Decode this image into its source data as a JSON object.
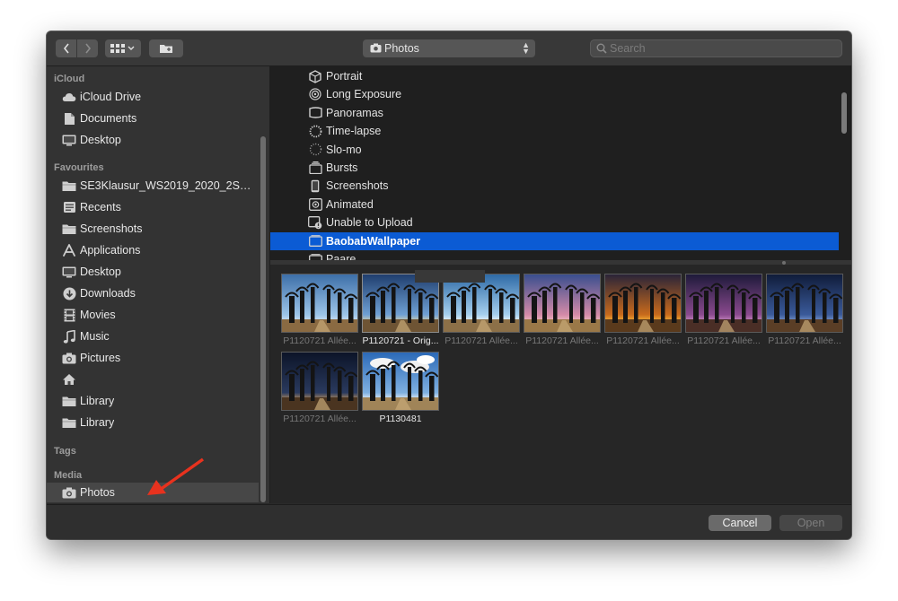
{
  "toolbar": {
    "back_icon": "chevron-left-icon",
    "forward_icon": "chevron-right-icon",
    "view_icon": "grid-view-icon",
    "new_folder_icon": "new-folder-icon",
    "location_label": "Photos",
    "location_icon": "camera-icon",
    "search_placeholder": "Search"
  },
  "sidebar": {
    "sections": [
      {
        "title": "iCloud",
        "items": [
          {
            "label": "iCloud Drive",
            "icon": "cloud-icon"
          },
          {
            "label": "Documents",
            "icon": "document-icon"
          },
          {
            "label": "Desktop",
            "icon": "desktop-icon"
          }
        ]
      },
      {
        "title": "Favourites",
        "items": [
          {
            "label": "SE3Klausur_WS2019_2020_2Sch...",
            "icon": "folder-icon"
          },
          {
            "label": "Recents",
            "icon": "recents-icon"
          },
          {
            "label": "Screenshots",
            "icon": "folder-icon"
          },
          {
            "label": "Applications",
            "icon": "applications-icon"
          },
          {
            "label": "Desktop",
            "icon": "desktop-icon"
          },
          {
            "label": "Downloads",
            "icon": "download-icon"
          },
          {
            "label": "Movies",
            "icon": "film-icon"
          },
          {
            "label": "Music",
            "icon": "music-note-icon"
          },
          {
            "label": "Pictures",
            "icon": "camera-icon"
          },
          {
            "label": "",
            "icon": "home-icon"
          },
          {
            "label": "Library",
            "icon": "folder-icon"
          },
          {
            "label": "Library",
            "icon": "folder-icon"
          }
        ]
      },
      {
        "title": "Tags",
        "items": []
      },
      {
        "title": "Media",
        "items": [
          {
            "label": "Photos",
            "icon": "camera-icon",
            "selected": true
          }
        ]
      }
    ]
  },
  "album_list": [
    {
      "label": "Portrait",
      "icon": "cube-icon"
    },
    {
      "label": "Long Exposure",
      "icon": "concentric-circles-icon"
    },
    {
      "label": "Panoramas",
      "icon": "panorama-icon"
    },
    {
      "label": "Time-lapse",
      "icon": "timelapse-icon"
    },
    {
      "label": "Slo-mo",
      "icon": "slomo-icon"
    },
    {
      "label": "Bursts",
      "icon": "stack-icon"
    },
    {
      "label": "Screenshots",
      "icon": "phone-icon"
    },
    {
      "label": "Animated",
      "icon": "animated-icon"
    },
    {
      "label": "Unable to Upload",
      "icon": "upload-error-icon"
    },
    {
      "label": "BaobabWallpaper",
      "icon": "album-icon",
      "selected": true
    },
    {
      "label": "Paare",
      "icon": "album-icon"
    }
  ],
  "thumbnails": [
    {
      "label": "P1120721 Allée...",
      "sky": "#3d6fa8",
      "sky2": "#9cc4e8",
      "glow": "#d9e8f5",
      "ground": "#8a6a42"
    },
    {
      "label": "P1120721 - Orig...",
      "sky": "#1f3e6e",
      "sky2": "#6fa0d4",
      "glow": "#e8d8a8",
      "ground": "#6e5434",
      "bright": true,
      "selected": true
    },
    {
      "label": "P1120721 Allée...",
      "sky": "#2e6aa6",
      "sky2": "#a6d0ee",
      "glow": "#ffffff",
      "ground": "#8c7048"
    },
    {
      "label": "P1120721 Allée...",
      "sky": "#3a4e8e",
      "sky2": "#d48aa8",
      "glow": "#f4c6c6",
      "ground": "#9a7848"
    },
    {
      "label": "P1120721 Allée...",
      "sky": "#2a2438",
      "sky2": "#c86a1c",
      "glow": "#ffc640",
      "ground": "#5a3a1c"
    },
    {
      "label": "P1120721 Allée...",
      "sky": "#1e1a3a",
      "sky2": "#8a4a8e",
      "glow": "#d89ad0",
      "ground": "#4a2e26"
    },
    {
      "label": "P1120721 Allée...",
      "sky": "#101c3a",
      "sky2": "#3a5a9a",
      "glow": "#8aa6d8",
      "ground": "#5a3e26"
    },
    {
      "label": "P1120721 Allée...",
      "sky": "#0c1428",
      "sky2": "#2a3a5e",
      "glow": "#d0a060",
      "ground": "#4a3420"
    },
    {
      "label": "P1130481",
      "sky": "#2c6ab8",
      "sky2": "#7fb0e0",
      "glow": "#ffffff",
      "ground": "#a08458",
      "bright": true,
      "clouds": true
    }
  ],
  "footer": {
    "cancel_label": "Cancel",
    "open_label": "Open"
  },
  "annotation": {
    "arrow_color": "#e8321e"
  }
}
